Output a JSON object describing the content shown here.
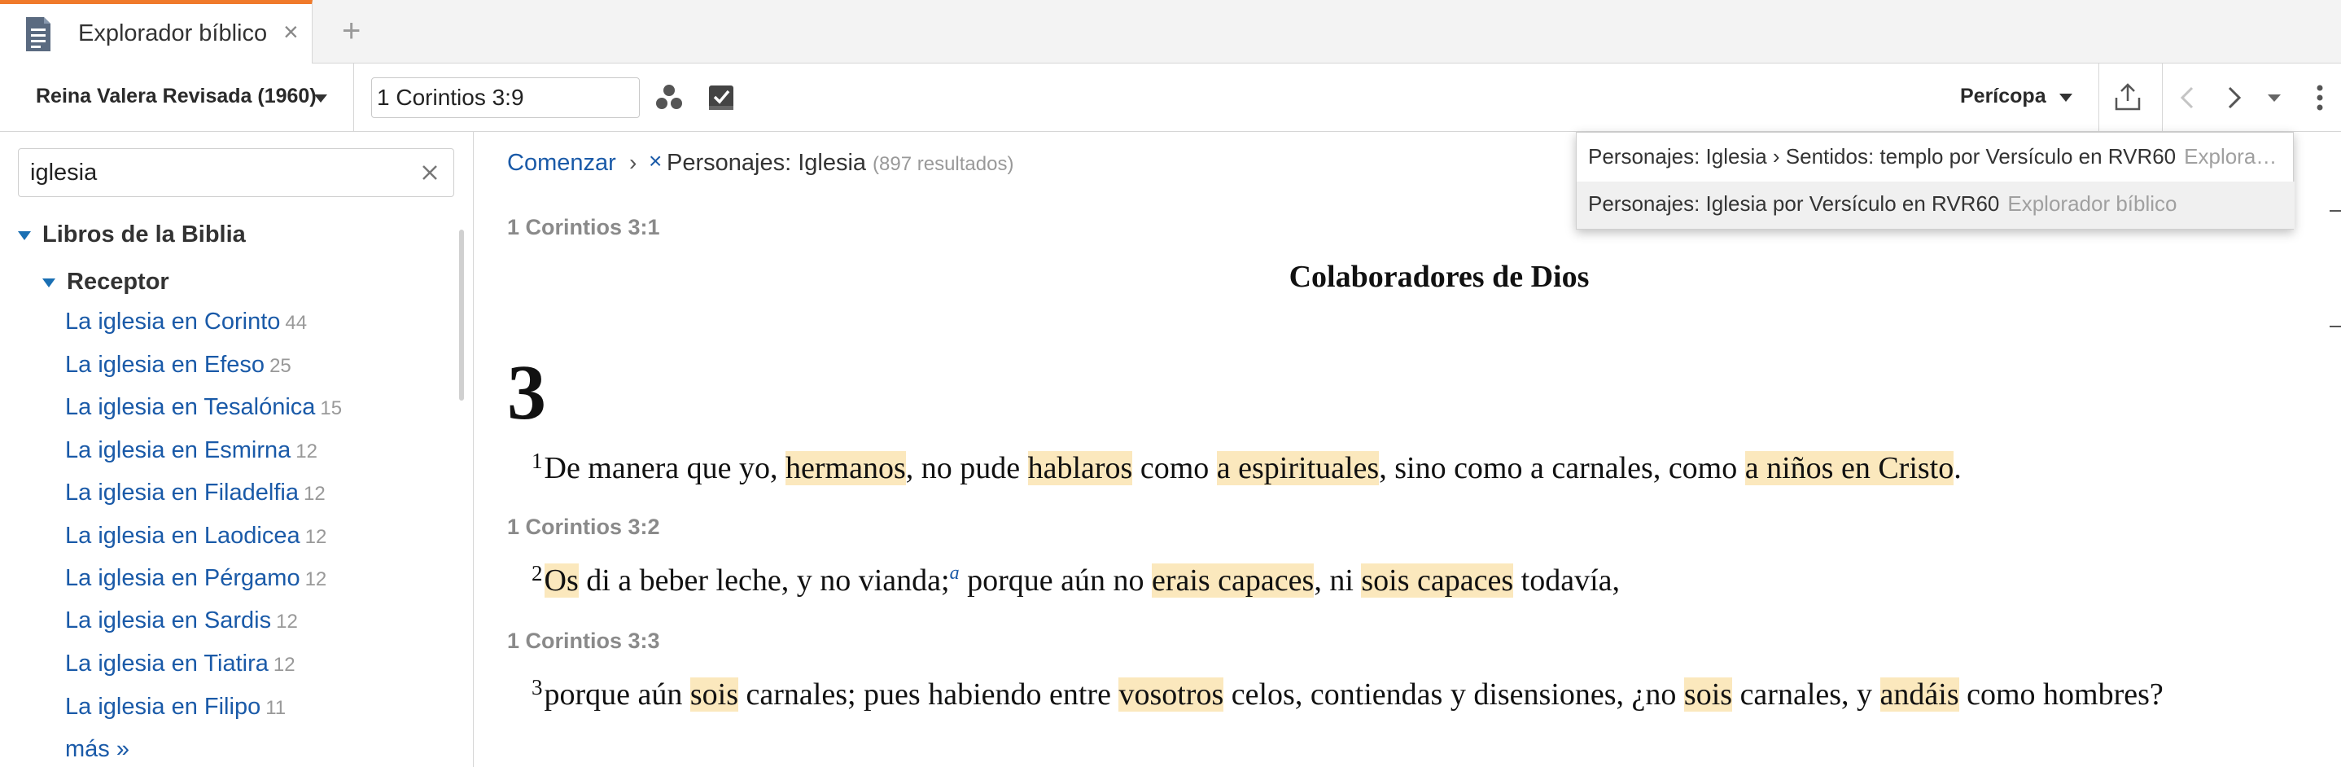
{
  "tabs": [
    {
      "title": "Explorador bíblico",
      "icon": "document-icon",
      "close": "×"
    }
  ],
  "add_tab_glyph": "+",
  "toolbar": {
    "version": "Reina Valera Revisada (1960)",
    "reference": "1 Corintios 3:9",
    "section_menu": "Perícopa",
    "icons": [
      "visual-filter-icon",
      "checklist-icon",
      "share-icon",
      "back-icon",
      "forward-icon",
      "history-dropdown-icon",
      "more-options-icon"
    ]
  },
  "sidebar": {
    "search_value": "iglesia",
    "root_label": "Libros de la Biblia",
    "group_label": "Receptor",
    "items": [
      {
        "label": "La iglesia en Corinto",
        "count": "44"
      },
      {
        "label": "La iglesia en Efeso",
        "count": "25"
      },
      {
        "label": "La iglesia en Tesalónica",
        "count": "15"
      },
      {
        "label": "La iglesia en Esmirna",
        "count": "12"
      },
      {
        "label": "La iglesia en Filadelfia",
        "count": "12"
      },
      {
        "label": "La iglesia en Laodicea",
        "count": "12"
      },
      {
        "label": "La iglesia en Pérgamo",
        "count": "12"
      },
      {
        "label": "La iglesia en Sardis",
        "count": "12"
      },
      {
        "label": "La iglesia en Tiatira",
        "count": "12"
      },
      {
        "label": "La iglesia en Filipo",
        "count": "11"
      }
    ],
    "more_link": "más »"
  },
  "breadcrumb": {
    "start": "Comenzar",
    "separator": "›",
    "remove_glyph": "×",
    "filter": "Personajes: Iglesia",
    "result_count": "(897 resultados)"
  },
  "dropdown": [
    {
      "text": "Personajes: Iglesia › Sentidos: templo por Versículo en RVR60",
      "muted": "Explora…"
    },
    {
      "text": "Personajes: Iglesia por Versículo en RVR60",
      "muted": "Explorador bíblico"
    }
  ],
  "passage": {
    "ref1": "1 Corintios 3:1",
    "heading": "Colaboradores de Dios",
    "chapter": "3",
    "ref2": "1 Corintios 3:2",
    "ref3": "1 Corintios 3:3",
    "verse1": {
      "num": "1",
      "t1": "De manera que yo, ",
      "h1": "hermanos",
      "t2": ", no pude ",
      "h2": "hablaros",
      "t3": " como ",
      "h3": "a espirituales",
      "t4": ", sino como a carnales, como ",
      "h4": "a niños en Cristo",
      "t5": "."
    },
    "verse2": {
      "num": "2",
      "h1": "Os",
      "t1": " di a beber leche, y no vianda;",
      "footnote": "a",
      "t2": " porque aún no ",
      "h2": "erais capaces",
      "t3": ", ni ",
      "h3": "sois capaces",
      "t4": " todavía,"
    },
    "verse3": {
      "num": "3",
      "t1": "porque aún ",
      "h1": "sois",
      "t2": " carnales; pues habiendo entre ",
      "h2": "vosotros",
      "t3": " celos, contiendas y disensiones, ¿no ",
      "h3": "sois",
      "t4": " carnales, y ",
      "h4": "andáis",
      "t5": " como hombres?"
    }
  },
  "colors": {
    "accent": "#f07a2b",
    "link": "#1a5aa8",
    "highlight": "#fbe8bd",
    "tree_triangle": "#1a6fb3"
  }
}
